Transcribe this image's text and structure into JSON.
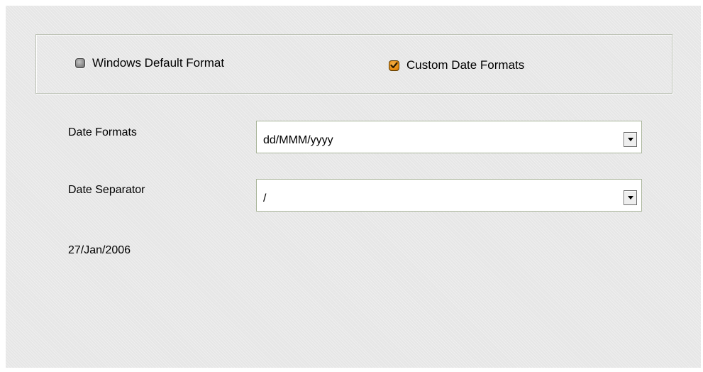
{
  "format_options": {
    "windows_default": {
      "label": "Windows Default Format",
      "checked": false
    },
    "custom_formats": {
      "label": "Custom Date Formats",
      "checked": true
    }
  },
  "date_formats": {
    "label": "Date Formats",
    "value": "dd/MMM/yyyy"
  },
  "date_separator": {
    "label": "Date Separator",
    "value": "/"
  },
  "preview": {
    "text": "27/Jan/2006"
  },
  "colors": {
    "accent_checked": "#e58b0f",
    "panel_bg": "#e6e6e6",
    "border": "#b9bfb2"
  },
  "icons": {
    "dropdown": "chevron-down-icon",
    "checked": "check-icon"
  }
}
